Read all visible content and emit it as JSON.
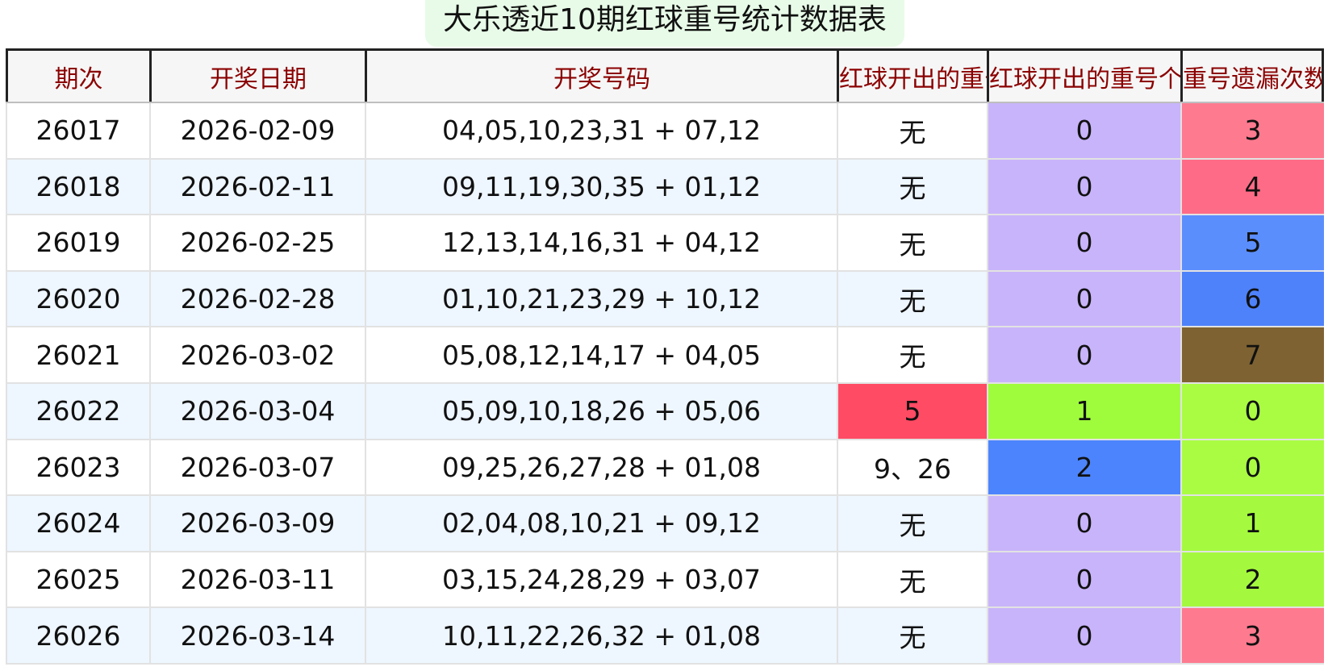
{
  "title": "大乐透近10期红球重号统计数据表",
  "headers": [
    "期次",
    "开奖日期",
    "开奖号码",
    "红球开出的重号",
    "红球开出的重号个数",
    "重号遗漏次数"
  ],
  "rows": [
    {
      "issue": "26017",
      "date": "2026-02-09",
      "numbers": "04,05,10,23,31 + 07,12",
      "repeat": "无",
      "repeat_count": "0",
      "miss": "3",
      "repeat_color": "",
      "count_color": "#c8b4fa",
      "miss_color": "#fd7a8f"
    },
    {
      "issue": "26018",
      "date": "2026-02-11",
      "numbers": "09,11,19,30,35 + 01,12",
      "repeat": "无",
      "repeat_count": "0",
      "miss": "4",
      "repeat_color": "",
      "count_color": "#c8b4fa",
      "miss_color": "#fe6b86"
    },
    {
      "issue": "26019",
      "date": "2026-02-25",
      "numbers": "12,13,14,16,31 + 04,12",
      "repeat": "无",
      "repeat_count": "0",
      "miss": "5",
      "repeat_color": "",
      "count_color": "#c8b4fa",
      "miss_color": "#5b8efd"
    },
    {
      "issue": "26020",
      "date": "2026-02-28",
      "numbers": "01,10,21,23,29 + 10,12",
      "repeat": "无",
      "repeat_count": "0",
      "miss": "6",
      "repeat_color": "",
      "count_color": "#c8b4fa",
      "miss_color": "#4e82fb"
    },
    {
      "issue": "26021",
      "date": "2026-03-02",
      "numbers": "05,08,12,14,17 + 04,05",
      "repeat": "无",
      "repeat_count": "0",
      "miss": "7",
      "repeat_color": "",
      "count_color": "#c8b4fa",
      "miss_color": "#7e6232"
    },
    {
      "issue": "26022",
      "date": "2026-03-04",
      "numbers": "05,09,10,18,26 + 05,06",
      "repeat": "5",
      "repeat_count": "1",
      "miss": "0",
      "repeat_color": "#ff4b64",
      "count_color": "#9ffc3c",
      "miss_color": "#aafc43"
    },
    {
      "issue": "26023",
      "date": "2026-03-07",
      "numbers": "09,25,26,27,28 + 01,08",
      "repeat": "9、26",
      "repeat_count": "2",
      "miss": "0",
      "repeat_color": "",
      "count_color": "#4c84fd",
      "miss_color": "#aafc43"
    },
    {
      "issue": "26024",
      "date": "2026-03-09",
      "numbers": "02,04,08,10,21 + 09,12",
      "repeat": "无",
      "repeat_count": "0",
      "miss": "1",
      "repeat_color": "",
      "count_color": "#c8b4fa",
      "miss_color": "#a5fa3f"
    },
    {
      "issue": "26025",
      "date": "2026-03-11",
      "numbers": "03,15,24,28,29 + 03,07",
      "repeat": "无",
      "repeat_count": "0",
      "miss": "2",
      "repeat_color": "",
      "count_color": "#c8b4fa",
      "miss_color": "#a4f93e"
    },
    {
      "issue": "26026",
      "date": "2026-03-14",
      "numbers": "10,11,22,26,32 + 01,08",
      "repeat": "无",
      "repeat_count": "0",
      "miss": "3",
      "repeat_color": "",
      "count_color": "#c8b4fa",
      "miss_color": "#fd7a8f"
    }
  ]
}
